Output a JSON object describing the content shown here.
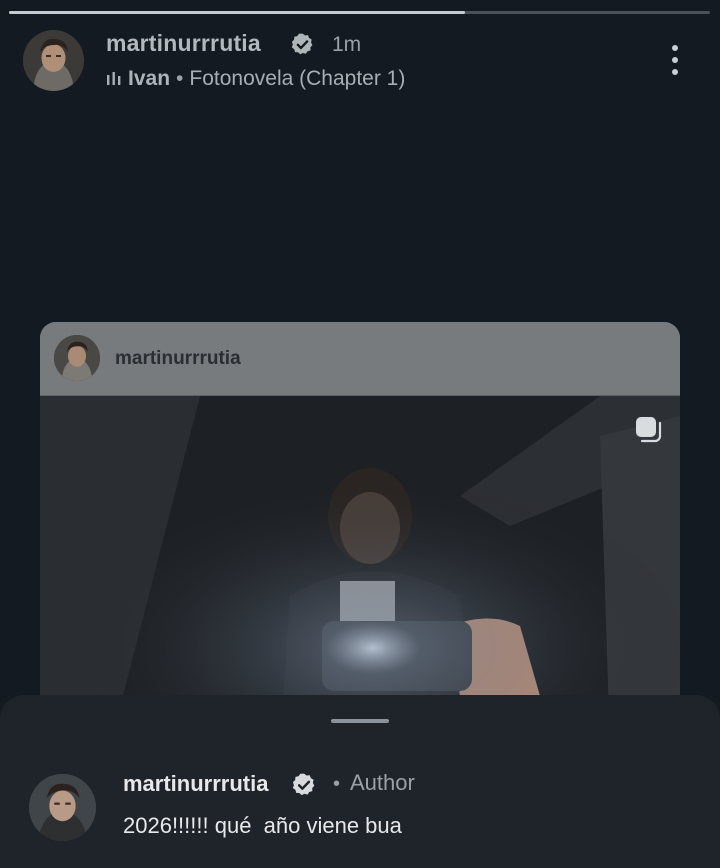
{
  "story": {
    "progress": 0.65,
    "username": "martinurrrutia",
    "time": "1m",
    "song": "Ivan",
    "separator": "•",
    "artist_line": "Fotonovela (Chapter 1)"
  },
  "post_card": {
    "username": "martinurrrutia"
  },
  "comment": {
    "username": "martinurrrutia",
    "dot": "•",
    "role": "Author",
    "text": "2026!!!!!! qué  año viene bua"
  },
  "icons": {
    "verified": "verified-badge-icon",
    "more": "more-vertical-icon",
    "music": "music-bars-icon",
    "carousel": "carousel-icon"
  },
  "colors": {
    "background": "#131a22",
    "sheet": "#1f242a",
    "verified_badge": "#b0b5ba"
  }
}
